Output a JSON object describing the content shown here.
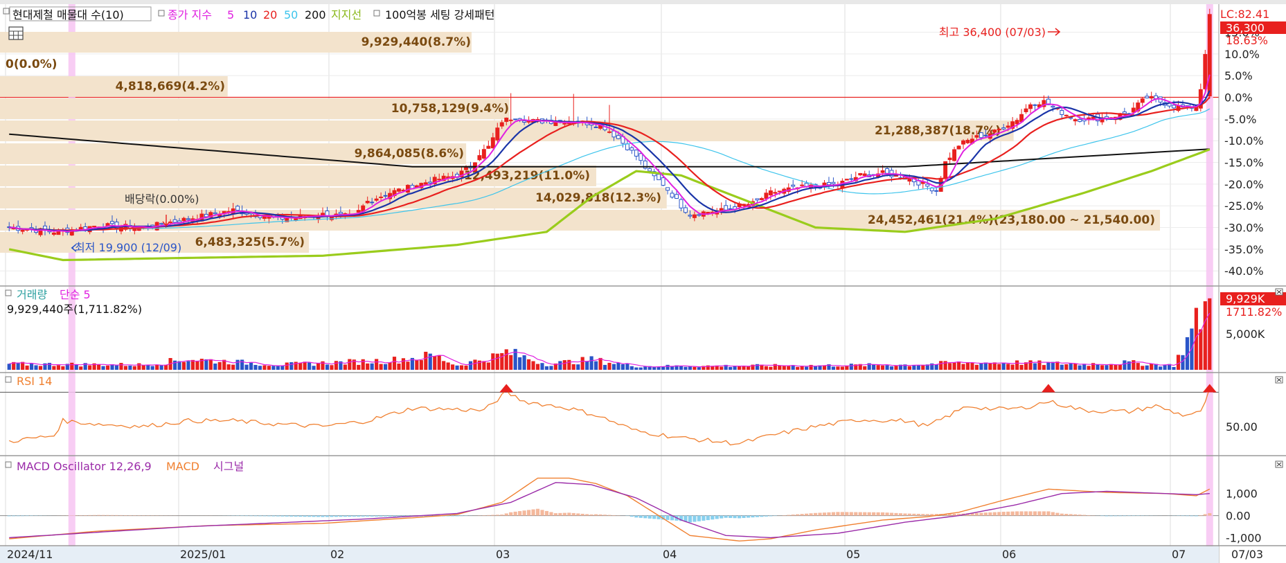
{
  "header": {
    "stock_label": "현대제철 매물대 수(10)",
    "ma_label": "종가 지수",
    "ma_periods": [
      "5",
      "10",
      "20",
      "50",
      "200"
    ],
    "support_label": "지지선",
    "pattern_label": "100억봉 세팅 강세패턴"
  },
  "right_badges": {
    "lc": "LC:82.41",
    "price": "36,300",
    "pct": "18.63%"
  },
  "price_panel": {
    "high_note": "최고 36,400 (07/03)",
    "low_note": "최저 19,900 (12/09)",
    "dividend_note": "배당락(0.00%)",
    "y_ticks": [
      "15.0%",
      "10.0%",
      "5.0%",
      "0.0%",
      "-5.0%",
      "-10.0%",
      "-15.0%",
      "-20.0%",
      "-25.0%",
      "-30.0%",
      "-35.0%",
      "-40.0%"
    ],
    "volume_profile": [
      {
        "label": "9,929,440(8.7%)",
        "value": 9929440,
        "pct": 8.7
      },
      {
        "label": "0(0.0%)",
        "value": 0,
        "pct": 0.0
      },
      {
        "label": "4,818,669(4.2%)",
        "value": 4818669,
        "pct": 4.2
      },
      {
        "label": "10,758,129(9.4%)",
        "value": 10758129,
        "pct": 9.4
      },
      {
        "label": "21,288,387(18.7%)",
        "value": 21288387,
        "pct": 18.7
      },
      {
        "label": "9,864,085(8.6%)",
        "value": 9864085,
        "pct": 8.6
      },
      {
        "label": "12,493,219(11.0%)",
        "value": 12493219,
        "pct": 11.0
      },
      {
        "label": "14,029,818(12.3%)",
        "value": 14029818,
        "pct": 12.3
      },
      {
        "label": "24,452,461(21.4%)(23,180.00 ~ 21,540.00)",
        "value": 24452461,
        "pct": 21.4
      },
      {
        "label": "6,483,325(5.7%)",
        "value": 6483325,
        "pct": 5.7
      }
    ]
  },
  "volume_panel": {
    "title": "거래량",
    "ma_label": "단순 5",
    "summary": "9,929,440주(1,711.82%)",
    "badge_value": "9,929K",
    "badge_pct": "1711.82%",
    "y_ticks": [
      "5,000K"
    ]
  },
  "rsi_panel": {
    "title": "RSI 14",
    "y_ticks": [
      "50.00"
    ]
  },
  "macd_panel": {
    "title": "MACD Oscillator 12,26,9",
    "macd_label": "MACD",
    "signal_label": "시그널",
    "y_ticks": [
      "1,000",
      "0.00",
      "-1,000"
    ]
  },
  "x_axis": {
    "labels": [
      "2024/11",
      "2025/01",
      "02",
      "03",
      "04",
      "05",
      "06",
      "07"
    ],
    "current": "07/03"
  },
  "colors": {
    "up": "#e8201e",
    "down": "#2a55c8",
    "ma5": "#e020e0",
    "ma10": "#1a34a8",
    "ma20": "#e8201e",
    "ma50": "#3cc4ec",
    "ma200": "#111111",
    "support": "#9acc1c",
    "profile": "#f3e3cc",
    "profile_text": "#7a4a10",
    "rsi": "#f08030",
    "macd": "#f08030",
    "signal": "#9a2aa8",
    "osc_pos": "#f4b89c",
    "osc_neg": "#88d0ee",
    "highlight": "#f7c4f2"
  },
  "chart_data": {
    "type": "candlestick",
    "units": "price % vs reference 30,600 (0.0%)",
    "high": {
      "value": 36400,
      "date": "07/03"
    },
    "low": {
      "value": 19900,
      "date": "12/09"
    },
    "last": {
      "price": 36300,
      "pct": 18.63
    },
    "y_range_pct": [
      -43,
      17
    ],
    "closes_pct_keypoints": [
      [
        0,
        -30
      ],
      [
        10,
        -31
      ],
      [
        14,
        -30.5
      ],
      [
        20,
        -29.5
      ],
      [
        30,
        -30
      ],
      [
        40,
        -28
      ],
      [
        50,
        -26
      ],
      [
        60,
        -28
      ],
      [
        70,
        -27
      ],
      [
        77,
        -27.5
      ],
      [
        80,
        -24
      ],
      [
        85,
        -22
      ],
      [
        90,
        -20.5
      ],
      [
        95,
        -19
      ],
      [
        100,
        -18
      ],
      [
        103,
        -16
      ],
      [
        105,
        -13
      ],
      [
        107,
        -11.5
      ],
      [
        110,
        -5.5
      ],
      [
        113,
        -4.5
      ],
      [
        116,
        -5.5
      ],
      [
        120,
        -5.5
      ],
      [
        125,
        -5.5
      ],
      [
        130,
        -6
      ],
      [
        133,
        -7
      ],
      [
        136,
        -9.5
      ],
      [
        140,
        -13.5
      ],
      [
        143,
        -17.5
      ],
      [
        146,
        -20
      ],
      [
        148,
        -22.5
      ],
      [
        150,
        -25
      ],
      [
        152,
        -27
      ],
      [
        155,
        -26.5
      ],
      [
        160,
        -26
      ],
      [
        163,
        -25
      ],
      [
        166,
        -24.5
      ],
      [
        170,
        -22
      ],
      [
        175,
        -21
      ],
      [
        180,
        -20.5
      ],
      [
        185,
        -20
      ],
      [
        190,
        -18
      ],
      [
        195,
        -17.5
      ],
      [
        200,
        -18.5
      ],
      [
        204,
        -20
      ],
      [
        207,
        -21.5
      ],
      [
        209,
        -15
      ],
      [
        212,
        -11
      ],
      [
        215,
        -9.5
      ],
      [
        220,
        -8
      ],
      [
        225,
        -5
      ],
      [
        228,
        -1.5
      ],
      [
        231,
        -1
      ],
      [
        234,
        -3
      ],
      [
        238,
        -5
      ],
      [
        242,
        -5
      ],
      [
        246,
        -4.5
      ],
      [
        250,
        -3.5
      ],
      [
        254,
        0
      ],
      [
        257,
        -1
      ],
      [
        260,
        -2
      ],
      [
        263,
        -2.5
      ],
      [
        265,
        -2
      ],
      [
        266,
        2
      ],
      [
        268,
        18.6
      ]
    ],
    "moving_averages": [
      "5",
      "10",
      "20",
      "50",
      "200"
    ],
    "volume_k_keypoints": [
      [
        0,
        800
      ],
      [
        30,
        700
      ],
      [
        40,
        1500
      ],
      [
        60,
        700
      ],
      [
        85,
        1300
      ],
      [
        95,
        2000
      ],
      [
        100,
        600
      ],
      [
        110,
        2100
      ],
      [
        111,
        2500
      ],
      [
        120,
        800
      ],
      [
        130,
        1400
      ],
      [
        140,
        500
      ],
      [
        180,
        600
      ],
      [
        200,
        700
      ],
      [
        209,
        900
      ],
      [
        215,
        1000
      ],
      [
        225,
        1000
      ],
      [
        240,
        800
      ],
      [
        250,
        1000
      ],
      [
        260,
        600
      ],
      [
        268,
        9929
      ]
    ],
    "rsi_keypoints": [
      [
        0,
        37
      ],
      [
        10,
        42
      ],
      [
        12,
        55
      ],
      [
        20,
        52
      ],
      [
        30,
        50
      ],
      [
        40,
        55
      ],
      [
        50,
        55
      ],
      [
        60,
        52
      ],
      [
        70,
        50
      ],
      [
        80,
        55
      ],
      [
        90,
        66
      ],
      [
        100,
        65
      ],
      [
        106,
        64
      ],
      [
        111,
        80
      ],
      [
        115,
        72
      ],
      [
        125,
        66
      ],
      [
        131,
        60
      ],
      [
        140,
        46
      ],
      [
        150,
        40
      ],
      [
        160,
        36
      ],
      [
        163,
        35
      ],
      [
        170,
        42
      ],
      [
        180,
        50
      ],
      [
        190,
        56
      ],
      [
        200,
        55
      ],
      [
        205,
        50
      ],
      [
        210,
        60
      ],
      [
        214,
        68
      ],
      [
        220,
        65
      ],
      [
        226,
        66
      ],
      [
        232,
        72
      ],
      [
        240,
        64
      ],
      [
        250,
        63
      ],
      [
        256,
        68
      ],
      [
        262,
        60
      ],
      [
        266,
        62
      ],
      [
        268,
        82
      ]
    ],
    "macd_keypoints": [
      [
        0,
        -1050
      ],
      [
        20,
        -700
      ],
      [
        45,
        -450
      ],
      [
        70,
        -350
      ],
      [
        90,
        -100
      ],
      [
        100,
        50
      ],
      [
        110,
        600
      ],
      [
        118,
        1700
      ],
      [
        125,
        1700
      ],
      [
        131,
        1450
      ],
      [
        138,
        900
      ],
      [
        145,
        0
      ],
      [
        152,
        -900
      ],
      [
        163,
        -1150
      ],
      [
        170,
        -1050
      ],
      [
        180,
        -650
      ],
      [
        195,
        -200
      ],
      [
        205,
        -50
      ],
      [
        212,
        150
      ],
      [
        222,
        700
      ],
      [
        232,
        1200
      ],
      [
        245,
        1050
      ],
      [
        258,
        1000
      ],
      [
        265,
        900
      ],
      [
        268,
        1200
      ]
    ],
    "signal_keypoints": [
      [
        0,
        -1000
      ],
      [
        40,
        -500
      ],
      [
        80,
        -150
      ],
      [
        100,
        100
      ],
      [
        112,
        600
      ],
      [
        122,
        1500
      ],
      [
        130,
        1400
      ],
      [
        140,
        800
      ],
      [
        150,
        -200
      ],
      [
        160,
        -900
      ],
      [
        170,
        -1000
      ],
      [
        185,
        -800
      ],
      [
        200,
        -300
      ],
      [
        212,
        0
      ],
      [
        225,
        500
      ],
      [
        235,
        1000
      ],
      [
        245,
        1100
      ],
      [
        258,
        1000
      ],
      [
        265,
        950
      ],
      [
        268,
        1000
      ]
    ]
  }
}
